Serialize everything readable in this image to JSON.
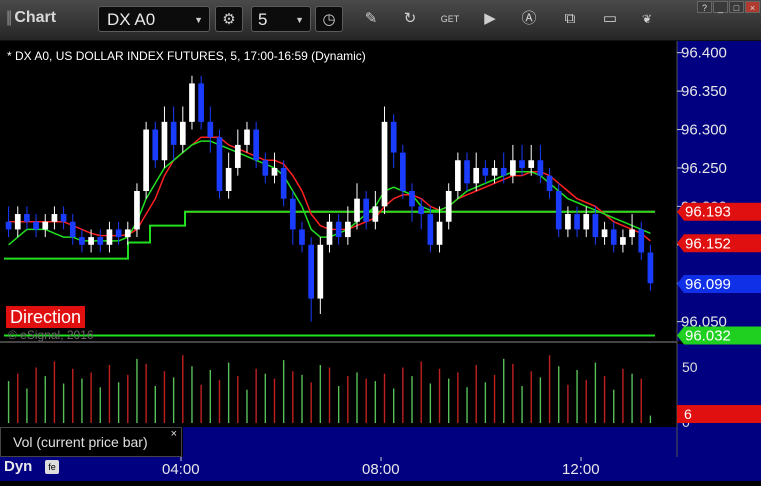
{
  "app": {
    "title": "Chart"
  },
  "toolbar": {
    "symbol": "DX A0",
    "interval": "5",
    "icons": [
      "settings-icon",
      "clock-icon",
      "pencil-icon",
      "refresh-icon",
      "get-icon",
      "play-icon",
      "alert-icon",
      "link-icon",
      "chat-icon",
      "twitter-icon"
    ]
  },
  "study": {
    "label": "* DX A0, US DOLLAR INDEX FUTURES, 5, 17:00-16:59 (Dynamic)"
  },
  "price_axis": {
    "ticks": [
      "96.400",
      "96.350",
      "96.300",
      "96.250",
      "96.200",
      "96.150",
      "96.100",
      "96.050"
    ],
    "markers": [
      {
        "value": "96.193",
        "color": "#e01010"
      },
      {
        "value": "96.152",
        "color": "#e01010"
      },
      {
        "value": "96.099",
        "color": "#1030e8"
      },
      {
        "value": "96.032",
        "color": "#20d020"
      }
    ]
  },
  "volume_axis": {
    "ticks": [
      "50",
      "0"
    ],
    "marker": "6"
  },
  "volume_panel": {
    "legend": "Vol (current price bar)",
    "close": "×"
  },
  "overlay": {
    "direction": "Direction",
    "copyright": "© eSignal, 2016"
  },
  "time_axis": {
    "mode": "Dyn",
    "ticks": [
      "04:00",
      "08:00",
      "12:00"
    ]
  },
  "colors": {
    "up": "#ffffff",
    "down": "#1a3cff",
    "ma_red": "#ff2020",
    "ma_green": "#20e020",
    "axis_bg": "#000080"
  },
  "chart_data": {
    "type": "candlestick",
    "x": "bar_index",
    "ylim": [
      96.03,
      96.41
    ],
    "candles": [
      [
        96.18,
        96.17,
        96.2,
        96.16
      ],
      [
        96.17,
        96.19,
        96.2,
        96.16
      ],
      [
        96.19,
        96.18,
        96.2,
        96.17
      ],
      [
        96.18,
        96.17,
        96.19,
        96.16
      ],
      [
        96.17,
        96.18,
        96.19,
        96.16
      ],
      [
        96.18,
        96.19,
        96.2,
        96.17
      ],
      [
        96.19,
        96.18,
        96.2,
        96.17
      ],
      [
        96.18,
        96.16,
        96.19,
        96.15
      ],
      [
        96.16,
        96.15,
        96.17,
        96.14
      ],
      [
        96.15,
        96.16,
        96.17,
        96.14
      ],
      [
        96.16,
        96.15,
        96.17,
        96.14
      ],
      [
        96.15,
        96.17,
        96.18,
        96.14
      ],
      [
        96.17,
        96.16,
        96.18,
        96.15
      ],
      [
        96.16,
        96.17,
        96.18,
        96.15
      ],
      [
        96.17,
        96.22,
        96.23,
        96.16
      ],
      [
        96.22,
        96.3,
        96.31,
        96.21
      ],
      [
        96.3,
        96.26,
        96.31,
        96.25
      ],
      [
        96.26,
        96.31,
        96.33,
        96.25
      ],
      [
        96.31,
        96.28,
        96.33,
        96.26
      ],
      [
        96.28,
        96.31,
        96.33,
        96.27
      ],
      [
        96.31,
        96.36,
        96.37,
        96.3
      ],
      [
        96.36,
        96.31,
        96.37,
        96.3
      ],
      [
        96.31,
        96.29,
        96.33,
        96.27
      ],
      [
        96.29,
        96.22,
        96.3,
        96.21
      ],
      [
        96.22,
        96.25,
        96.27,
        96.21
      ],
      [
        96.25,
        96.28,
        96.3,
        96.24
      ],
      [
        96.28,
        96.3,
        96.31,
        96.27
      ],
      [
        96.3,
        96.26,
        96.31,
        96.25
      ],
      [
        96.26,
        96.24,
        96.27,
        96.23
      ],
      [
        96.24,
        96.25,
        96.27,
        96.23
      ],
      [
        96.25,
        96.21,
        96.26,
        96.2
      ],
      [
        96.21,
        96.17,
        96.22,
        96.15
      ],
      [
        96.17,
        96.15,
        96.18,
        96.14
      ],
      [
        96.15,
        96.08,
        96.16,
        96.05
      ],
      [
        96.08,
        96.15,
        96.16,
        96.06
      ],
      [
        96.15,
        96.18,
        96.19,
        96.14
      ],
      [
        96.18,
        96.16,
        96.19,
        96.15
      ],
      [
        96.16,
        96.18,
        96.2,
        96.15
      ],
      [
        96.18,
        96.21,
        96.23,
        96.17
      ],
      [
        96.21,
        96.18,
        96.22,
        96.17
      ],
      [
        96.18,
        96.2,
        96.22,
        96.17
      ],
      [
        96.2,
        96.31,
        96.33,
        96.19
      ],
      [
        96.31,
        96.27,
        96.32,
        96.25
      ],
      [
        96.27,
        96.22,
        96.28,
        96.21
      ],
      [
        96.22,
        96.2,
        96.23,
        96.18
      ],
      [
        96.2,
        96.19,
        96.21,
        96.17
      ],
      [
        96.19,
        96.15,
        96.2,
        96.14
      ],
      [
        96.15,
        96.18,
        96.2,
        96.14
      ],
      [
        96.18,
        96.22,
        96.23,
        96.17
      ],
      [
        96.22,
        96.26,
        96.27,
        96.21
      ],
      [
        96.26,
        96.23,
        96.27,
        96.22
      ],
      [
        96.23,
        96.25,
        96.27,
        96.22
      ],
      [
        96.25,
        96.24,
        96.26,
        96.23
      ],
      [
        96.24,
        96.25,
        96.26,
        96.23
      ],
      [
        96.25,
        96.24,
        96.27,
        96.23
      ],
      [
        96.24,
        96.26,
        96.28,
        96.23
      ],
      [
        96.26,
        96.25,
        96.28,
        96.24
      ],
      [
        96.25,
        96.26,
        96.28,
        96.24
      ],
      [
        96.26,
        96.24,
        96.28,
        96.23
      ],
      [
        96.24,
        96.22,
        96.25,
        96.21
      ],
      [
        96.22,
        96.17,
        96.23,
        96.16
      ],
      [
        96.17,
        96.19,
        96.2,
        96.16
      ],
      [
        96.19,
        96.17,
        96.2,
        96.16
      ],
      [
        96.17,
        96.19,
        96.2,
        96.16
      ],
      [
        96.19,
        96.16,
        96.2,
        96.15
      ],
      [
        96.16,
        96.17,
        96.18,
        96.15
      ],
      [
        96.17,
        96.15,
        96.18,
        96.14
      ],
      [
        96.15,
        96.16,
        96.17,
        96.14
      ],
      [
        96.16,
        96.17,
        96.19,
        96.15
      ],
      [
        96.17,
        96.14,
        96.18,
        96.13
      ],
      [
        96.14,
        96.1,
        96.15,
        96.09
      ]
    ],
    "ma_red": [
      96.18,
      96.18,
      96.18,
      96.18,
      96.18,
      96.18,
      96.18,
      96.175,
      96.17,
      96.165,
      96.162,
      96.162,
      96.162,
      96.163,
      96.17,
      96.19,
      96.21,
      96.24,
      96.26,
      96.27,
      96.28,
      96.29,
      96.29,
      96.29,
      96.28,
      96.275,
      96.27,
      96.265,
      96.26,
      96.26,
      96.255,
      96.24,
      96.22,
      96.19,
      96.175,
      96.17,
      96.17,
      96.17,
      96.175,
      96.18,
      96.185,
      96.2,
      96.21,
      96.215,
      96.215,
      96.21,
      96.2,
      96.195,
      96.2,
      96.21,
      96.215,
      96.22,
      96.225,
      96.23,
      96.235,
      96.24,
      96.24,
      96.245,
      96.245,
      96.24,
      96.23,
      96.22,
      96.21,
      96.205,
      96.2,
      96.19,
      96.18,
      96.175,
      96.17,
      96.165,
      96.155
    ],
    "ma_green": [
      96.15,
      96.16,
      96.17,
      96.17,
      96.17,
      96.165,
      96.16,
      96.16,
      96.155,
      96.155,
      96.155,
      96.155,
      96.155,
      96.16,
      96.18,
      96.21,
      96.23,
      96.25,
      96.26,
      96.27,
      96.28,
      96.285,
      96.285,
      96.28,
      96.275,
      96.27,
      96.265,
      96.26,
      96.255,
      96.25,
      96.24,
      96.22,
      96.2,
      96.17,
      96.16,
      96.16,
      96.165,
      96.17,
      96.18,
      96.19,
      96.2,
      96.22,
      96.225,
      96.22,
      96.215,
      96.2,
      96.195,
      96.195,
      96.2,
      96.21,
      96.22,
      96.225,
      96.23,
      96.235,
      96.24,
      96.245,
      96.245,
      96.245,
      96.24,
      96.23,
      96.22,
      96.21,
      96.205,
      96.2,
      96.195,
      96.19,
      96.185,
      96.18,
      96.175,
      96.17,
      96.165
    ],
    "red_level": 96.193,
    "green_step_levels": [
      96.132,
      96.153,
      96.175,
      96.193
    ],
    "green_line": 96.032,
    "volume": [
      34,
      40,
      28,
      45,
      38,
      50,
      32,
      44,
      36,
      41,
      29,
      47,
      33,
      39,
      52,
      48,
      30,
      42,
      37,
      55,
      46,
      31,
      43,
      35,
      49,
      38,
      27,
      44,
      40,
      36,
      51,
      42,
      39,
      33,
      47,
      45,
      30,
      38,
      41,
      36,
      34,
      40,
      28,
      45,
      38,
      50,
      32,
      44,
      36,
      41,
      29,
      47,
      33,
      39,
      52,
      48,
      30,
      42,
      37,
      55,
      46,
      31,
      43,
      35,
      49,
      38,
      27,
      44,
      40,
      36,
      6
    ],
    "volume_ylim": [
      0,
      60
    ]
  }
}
